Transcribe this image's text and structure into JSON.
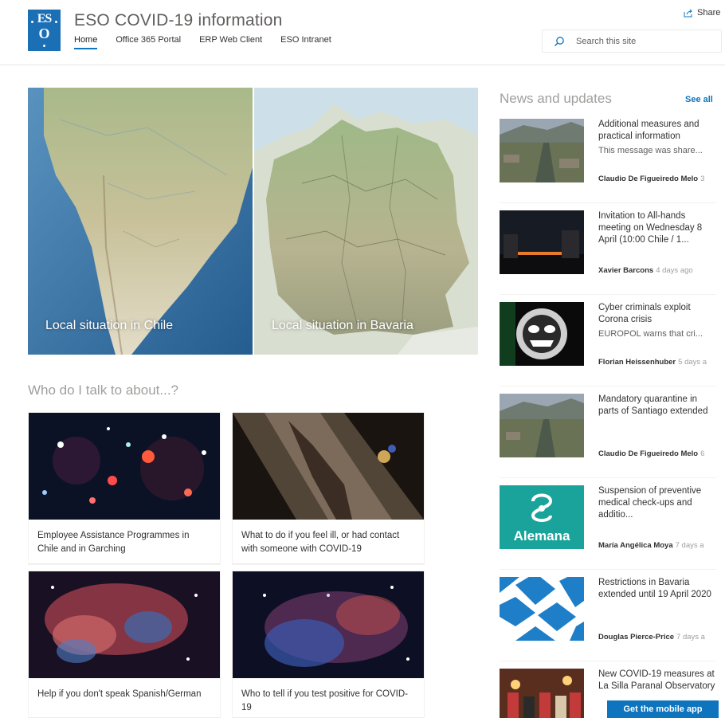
{
  "header": {
    "logo_text_top": "ES",
    "logo_text_bottom": "O",
    "site_title": "ESO COVID-19 information",
    "nav": [
      {
        "label": "Home",
        "active": true
      },
      {
        "label": "Office 365 Portal"
      },
      {
        "label": "ERP Web Client"
      },
      {
        "label": "ESO Intranet"
      }
    ],
    "share_label": "Share",
    "search_placeholder": "Search this site"
  },
  "hero": {
    "left_label": "Local situation in Chile",
    "right_label": "Local situation in Bavaria"
  },
  "talk_section": {
    "title": "Who do I talk to about...?",
    "cards": [
      {
        "caption": "Employee Assistance Programmes in Chile and in Garching"
      },
      {
        "caption": "What to do if you feel ill, or had contact with someone with COVID-19"
      },
      {
        "caption": "Help if you don't speak Spanish/German"
      },
      {
        "caption": "Who to tell if you test positive for COVID-19"
      }
    ]
  },
  "news": {
    "title": "News and updates",
    "see_all": "See all",
    "items": [
      {
        "title": "Additional measures and practical information",
        "desc": "This message was share...",
        "author": "Claudio De Figueiredo Melo",
        "time": "3"
      },
      {
        "title": "Invitation to All-hands meeting on Wednesday 8 April (10:00 Chile / 1...",
        "desc": "",
        "author": "Xavier Barcons",
        "time": "4 days ago"
      },
      {
        "title": "Cyber criminals exploit Corona crisis",
        "desc": "EUROPOL warns that cri...",
        "author": "Florian Heissenhuber",
        "time": "5 days a"
      },
      {
        "title": "Mandatory quarantine in parts of Santiago extended",
        "desc": "",
        "author": "Claudio De Figueiredo Melo",
        "time": "6"
      },
      {
        "title": "Suspension of preventive medical check-ups and additio...",
        "desc": "",
        "author": "María Angélica Moya",
        "time": "7 days a"
      },
      {
        "title": "Restrictions in Bavaria extended until 19 April 2020",
        "desc": "",
        "author": "Douglas Pierce-Price",
        "time": "7 days a"
      },
      {
        "title": "New COVID-19 measures at La Silla Paranal Observatory",
        "desc": "",
        "author": "",
        "time": ""
      }
    ],
    "thumb_5_text": "Alemana"
  },
  "mobile_app_button": "Get the mobile app",
  "colors": {
    "accent": "#0d74bd",
    "logo_blue": "#1a6fb5",
    "alemana_teal": "#1aa39b",
    "bavaria_blue": "#1e7ec8"
  }
}
